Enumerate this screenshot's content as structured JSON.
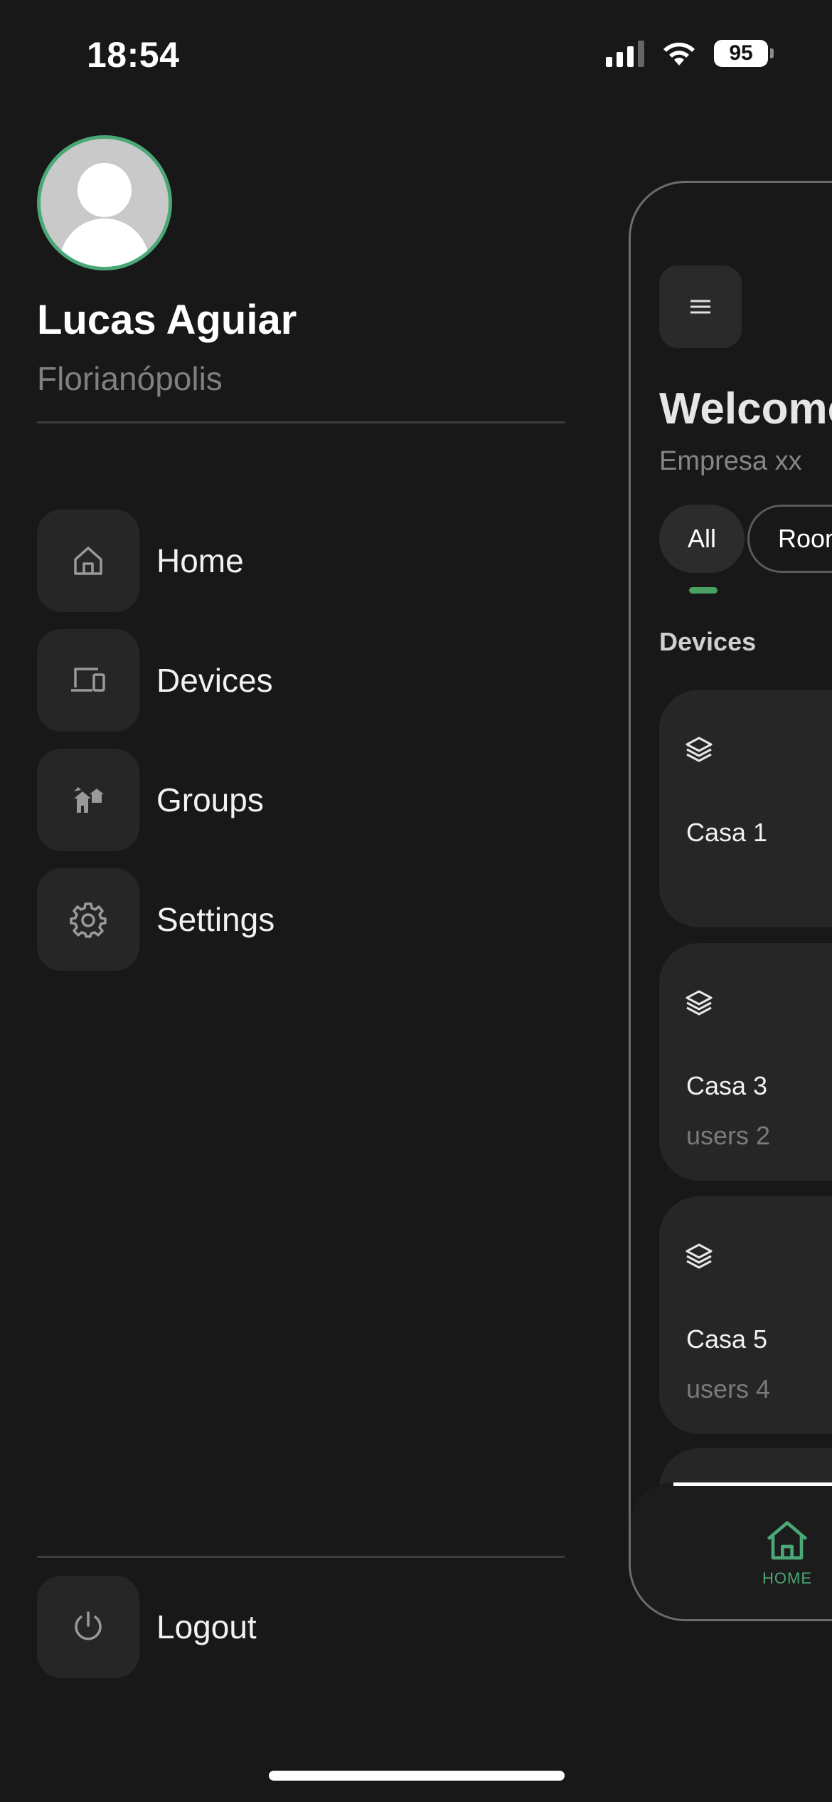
{
  "status_bar": {
    "time": "18:54",
    "battery": "95"
  },
  "profile": {
    "name": "Lucas Aguiar",
    "city": "Florianópolis"
  },
  "menu": {
    "items": [
      {
        "label": "Home",
        "icon": "home-icon"
      },
      {
        "label": "Devices",
        "icon": "devices-icon"
      },
      {
        "label": "Groups",
        "icon": "groups-icon"
      },
      {
        "label": "Settings",
        "icon": "gear-icon"
      }
    ],
    "logout_label": "Logout"
  },
  "panel": {
    "title": "Welcome",
    "subtitle": "Empresa xx",
    "chips": [
      "All",
      "Rooms"
    ],
    "section": "Devices",
    "cards": [
      {
        "name": "Casa 1",
        "sub": ""
      },
      {
        "name": "Casa 3",
        "sub": "users 2"
      },
      {
        "name": "Casa 5",
        "sub": "users 4"
      }
    ],
    "tab_home_label": "HOME"
  },
  "colors": {
    "background": "#181818",
    "accent": "#4aa876",
    "surface": "#262626"
  }
}
